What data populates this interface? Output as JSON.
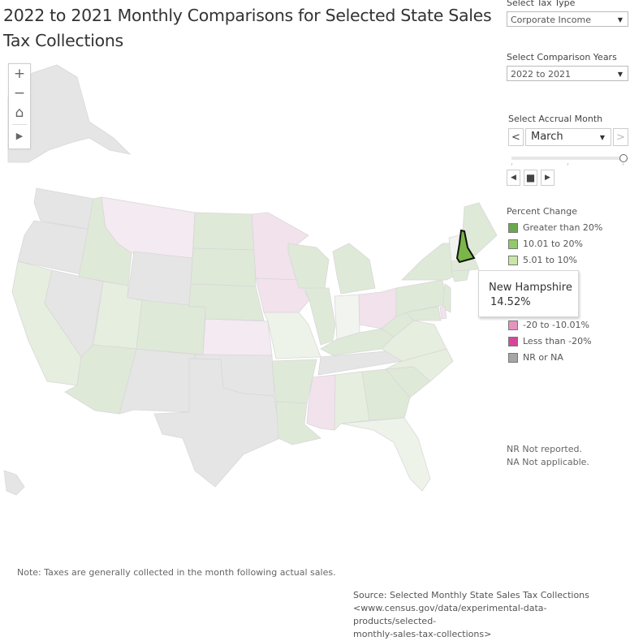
{
  "header": {
    "title": "2022 to 2021 Monthly Comparisons for Selected State Sales Tax Collections"
  },
  "filters": {
    "tax_type": {
      "label": "Select Tax Type",
      "value": "Corporate Income"
    },
    "comparison_years": {
      "label": "Select Comparison Years",
      "value": "2022 to 2021"
    },
    "accrual_month": {
      "label": "Select Accrual Month",
      "value": "March",
      "prev_icon": "<",
      "next_icon": ">"
    }
  },
  "slider": {
    "position_fraction": 1.0
  },
  "playback": {
    "back_icon": "◀",
    "stop_icon": "■",
    "forward_icon": "▶"
  },
  "map_controls": {
    "zoom_in": "+",
    "zoom_out": "−",
    "home": "⌂",
    "expand": "▶"
  },
  "legend": {
    "title": "Percent Change",
    "items": [
      {
        "label": "Greater than 20%",
        "color": "#6aa84f"
      },
      {
        "label": "10.01 to 20%",
        "color": "#93c96a"
      },
      {
        "label": "5.01 to 10%",
        "color": "#c9e6a6"
      },
      {
        "label": "-20 to -10.01%",
        "color": "#e593c0"
      },
      {
        "label": "Less than -20%",
        "color": "#d6479a"
      },
      {
        "label": "NR or NA",
        "color": "#a6a6a6"
      }
    ]
  },
  "tooltip": {
    "state": "New Hampshire",
    "value": "14.52%"
  },
  "abbrev_notes": [
    "NR Not reported.",
    "NA Not applicable."
  ],
  "footer": {
    "note": "Note: Taxes are generally collected in the month following actual sales.",
    "source_lines": [
      "Source: Selected Monthly State Sales Tax Collections",
      "<www.census.gov/data/experimental-data-products/selected-",
      "monthly-sales-tax-collections>"
    ]
  },
  "colors": {
    "highlight": "#7ab648",
    "dim_green": "#dfe9d8",
    "dim_lightgreen": "#e6eedf",
    "dim_pale": "#eef3ea",
    "dim_pink": "#f2e2ec",
    "dim_lightpink": "#f4eaf1",
    "dim_gray": "#e5e5e5",
    "dim_white": "#f2f4f0"
  }
}
